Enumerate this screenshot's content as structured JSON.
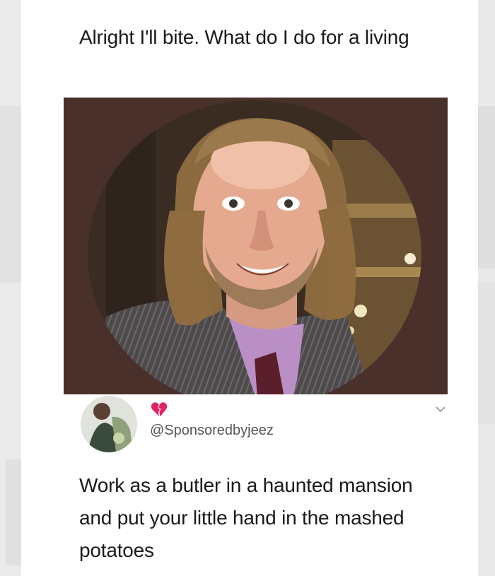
{
  "post": {
    "question": "Alright I'll bite. What do I do for a living"
  },
  "photo": {
    "subject": "selfie-man-smiling"
  },
  "reply": {
    "handle": "@Sponsoredbyjeez",
    "heart_icon": "broken-heart-icon",
    "text": "Work as a butler in a haunted mansion and put your little hand in the mashed potatoes"
  },
  "colors": {
    "background": "#f3f3f3",
    "card": "#ffffff",
    "text": "#1a1a1a",
    "handle": "#555555",
    "photo_border": "#4a302b",
    "heart": "#e0245e"
  }
}
